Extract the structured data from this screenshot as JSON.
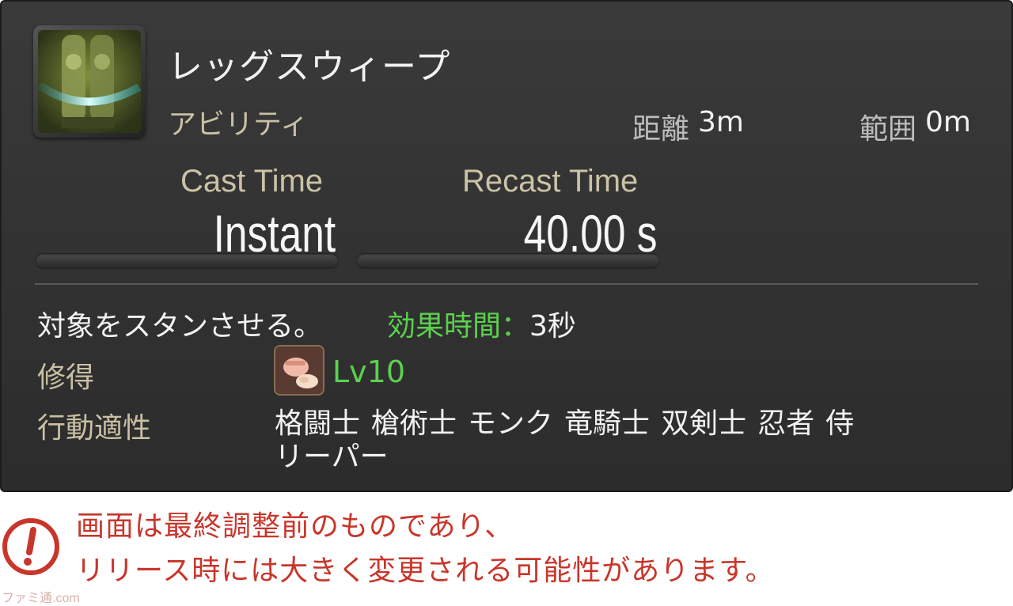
{
  "skill": {
    "name": "レッグスウィープ",
    "type": "アビリティ",
    "icon": "leg-sweep-icon",
    "range_label": "距離",
    "range_value": "3m",
    "radius_label": "範囲",
    "radius_value": "0m"
  },
  "stats": {
    "cast_label": "Cast Time",
    "cast_value": "Instant",
    "recast_label": "Recast Time",
    "recast_value": "40.00 s"
  },
  "description": {
    "text": "対象をスタンさせる。",
    "effect_label": "効果時間：",
    "effect_value": "3秒"
  },
  "acquire": {
    "label": "修得",
    "job_icon": "pugilist-fist-icon",
    "level": "Lv10"
  },
  "affinity": {
    "label": "行動適性",
    "jobs": [
      "格闘士",
      "槍術士",
      "モンク",
      "竜騎士",
      "双剣士",
      "忍者",
      "侍",
      "リーパー"
    ]
  },
  "notice": {
    "icon": "exclamation-circle-icon",
    "line1": "画面は最終調整前のものであり、",
    "line2": "リリース時には大きく変更される可能性があります。"
  },
  "watermark": "ファミ通.com",
  "colors": {
    "effect_green": "#5bd14e",
    "notice_red": "#c8362b",
    "label_tan": "#c9c0a4"
  }
}
